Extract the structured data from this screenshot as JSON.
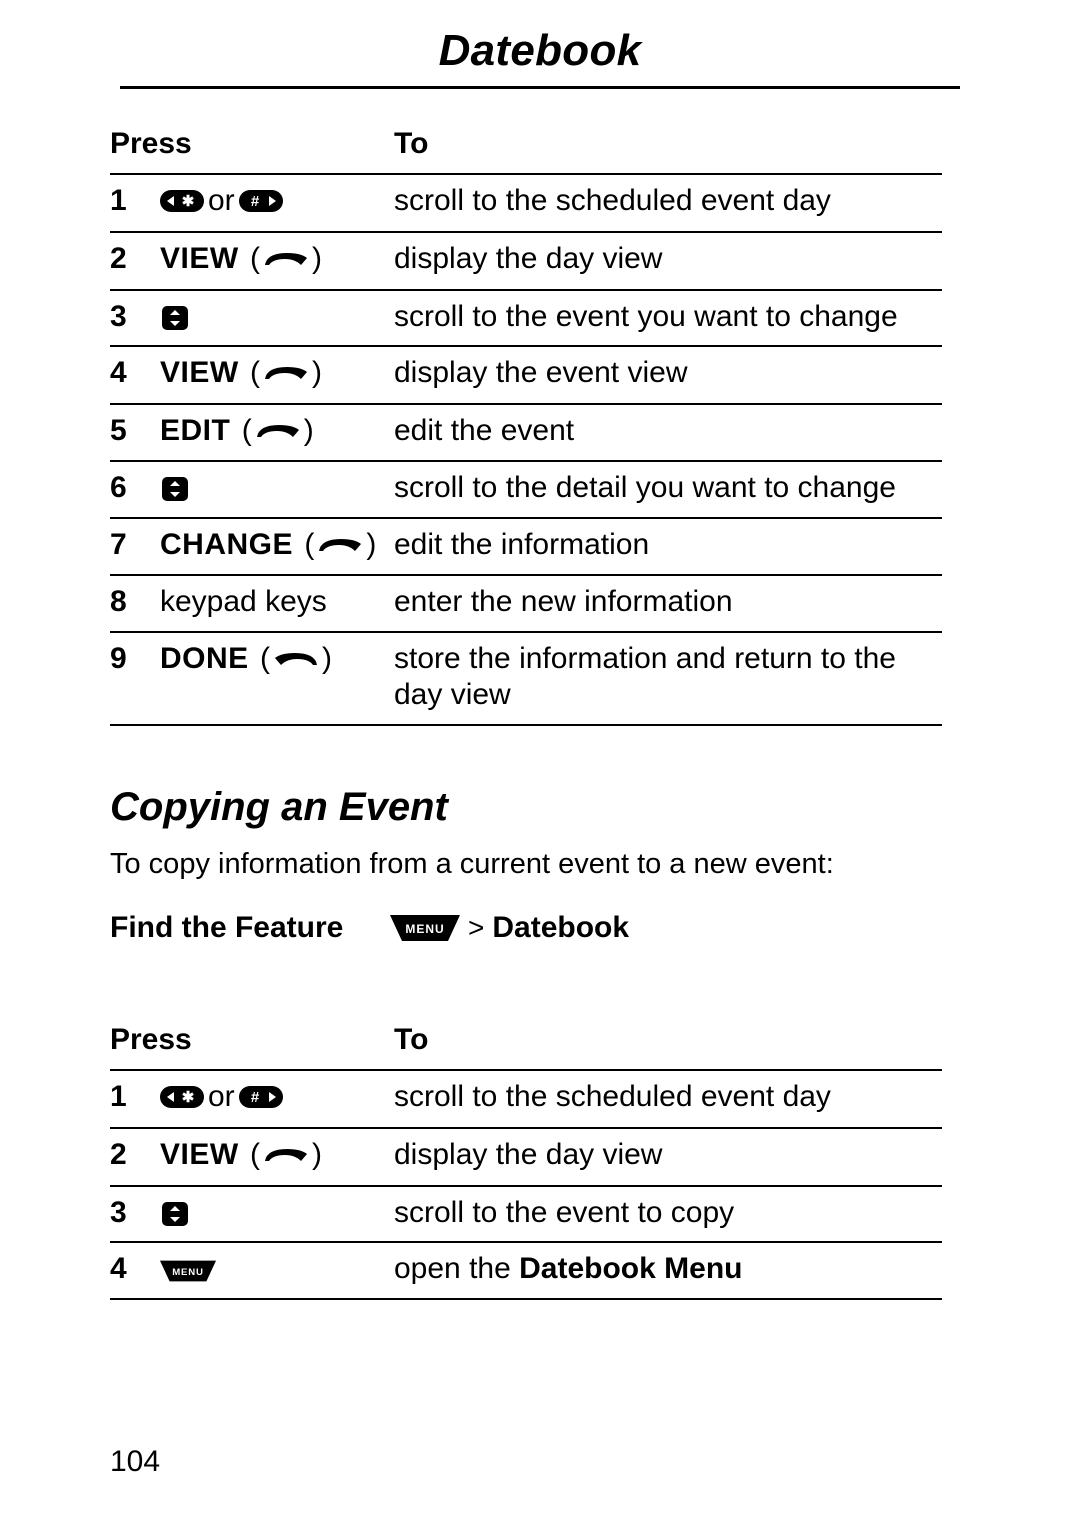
{
  "title": "Datebook",
  "table1": {
    "head_press": "Press",
    "head_to": "To",
    "rows": [
      {
        "n": "1",
        "to": "scroll to the scheduled event day"
      },
      {
        "n": "2",
        "label": "VIEW",
        "key": "right",
        "to": "display the day view"
      },
      {
        "n": "3",
        "to": "scroll to the event you want to change"
      },
      {
        "n": "4",
        "label": "VIEW",
        "key": "right",
        "to": "display the event view"
      },
      {
        "n": "5",
        "label": "EDIT",
        "key": "right",
        "to": "edit the event"
      },
      {
        "n": "6",
        "to": "scroll to the detail you want to change"
      },
      {
        "n": "7",
        "label": "CHANGE",
        "key": "right",
        "to": "edit the information"
      },
      {
        "n": "8",
        "press_text": "keypad keys",
        "to": "enter the new information"
      },
      {
        "n": "9",
        "label": "DONE",
        "key": "left",
        "to": "store the information and return to the day view"
      }
    ]
  },
  "section2": {
    "heading": "Copying an Event",
    "intro": "To copy information from a current event to a new event:",
    "feature_label": "Find the Feature",
    "feature_path_gt": ">",
    "feature_path_target": "Datebook"
  },
  "table2": {
    "head_press": "Press",
    "head_to": "To",
    "rows": [
      {
        "n": "1",
        "to": "scroll to the scheduled event day"
      },
      {
        "n": "2",
        "label": "VIEW",
        "key": "right",
        "to": "display the day view"
      },
      {
        "n": "3",
        "to": "scroll to the event to copy"
      },
      {
        "n": "4",
        "to_prefix": "open the ",
        "to_cond": "Datebook Menu"
      }
    ]
  },
  "or_word": "or",
  "page_number": "104"
}
